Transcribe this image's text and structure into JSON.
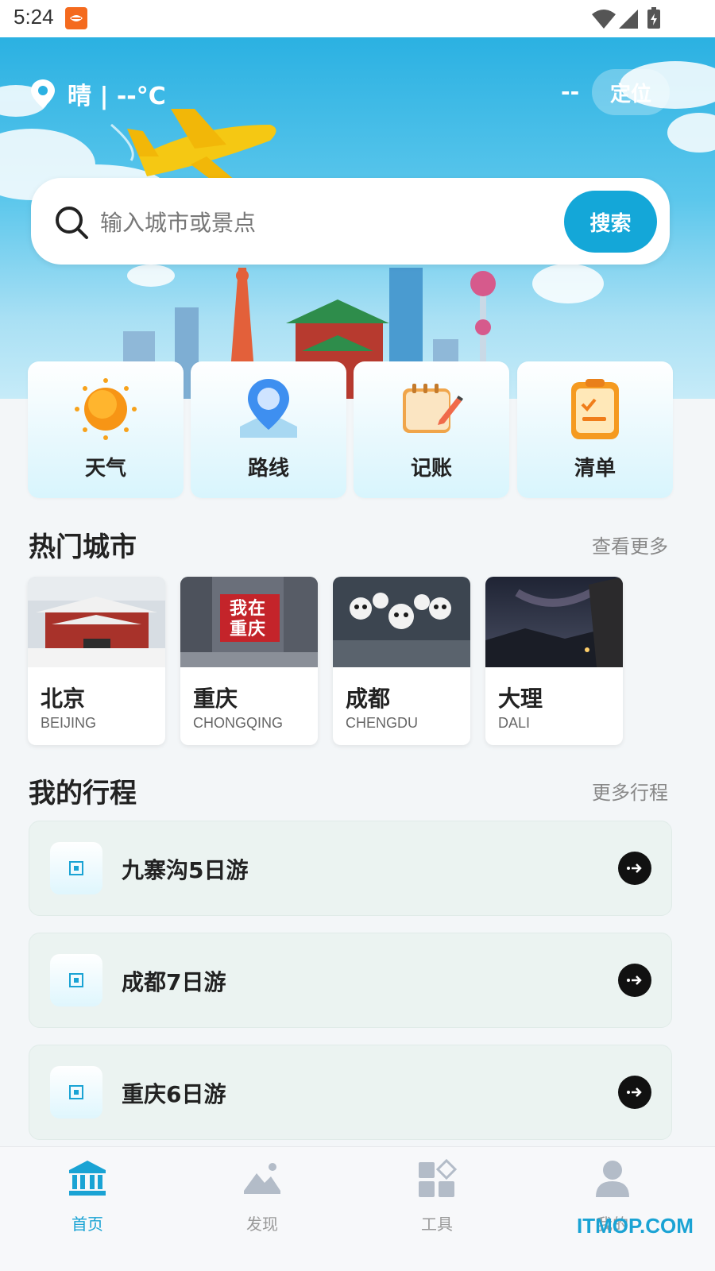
{
  "status_bar": {
    "time": "5:24"
  },
  "header": {
    "weather": "晴 | --°C",
    "temperature": "--",
    "locate_label": "定位"
  },
  "search": {
    "placeholder": "输入城市或景点",
    "button_label": "搜索"
  },
  "tools": [
    {
      "label": "天气",
      "icon": "sun-icon"
    },
    {
      "label": "路线",
      "icon": "map-pin-icon"
    },
    {
      "label": "记账",
      "icon": "notebook-icon"
    },
    {
      "label": "清单",
      "icon": "checklist-icon"
    }
  ],
  "hot_cities": {
    "title": "热门城市",
    "more_label": "查看更多",
    "items": [
      {
        "name": "北京",
        "en": "BEIJING"
      },
      {
        "name": "重庆",
        "en": "CHONGQING",
        "photo_text": "我在重庆"
      },
      {
        "name": "成都",
        "en": "CHENGDU"
      },
      {
        "name": "大理",
        "en": "DALI"
      }
    ]
  },
  "trips": {
    "title": "我的行程",
    "more_label": "更多行程",
    "items": [
      {
        "label": "九寨沟5日游"
      },
      {
        "label": "成都7日游"
      },
      {
        "label": "重庆6日游"
      }
    ]
  },
  "bottom_nav": {
    "items": [
      {
        "label": "首页",
        "icon": "home-icon",
        "active": true
      },
      {
        "label": "发现",
        "icon": "image-icon",
        "active": false
      },
      {
        "label": "工具",
        "icon": "apps-icon",
        "active": false
      },
      {
        "label": "我的",
        "icon": "user-icon",
        "active": false
      }
    ]
  },
  "watermark": "ITMOP.COM",
  "colors": {
    "accent": "#14a7d8",
    "hero": "#2bb1e2",
    "text": "#222222"
  }
}
